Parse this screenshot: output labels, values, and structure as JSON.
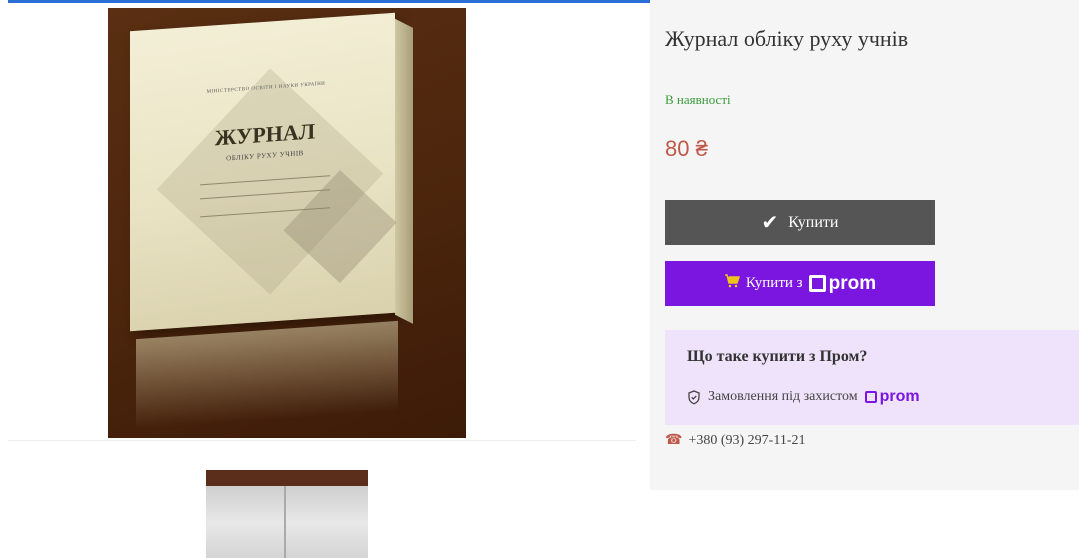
{
  "product": {
    "title": "Журнал обліку руху учнів",
    "availability": "В наявності",
    "price": "80 ₴"
  },
  "book_cover": {
    "ministry": "МІНІСТЕРСТВО ОСВІТИ І НАУКИ УКРАЇНИ",
    "title": "ЖУРНАЛ",
    "subtitle": "ОБЛІКУ РУХУ УЧНІВ"
  },
  "buttons": {
    "buy_label": "Купити",
    "buy_with_prom_label": "Купити з",
    "prom_logo_text": "prom"
  },
  "prom_info": {
    "title": "Що таке купити з Пром?",
    "protection_text": "Замовлення під захистом",
    "prom_logo_text": "prom"
  },
  "contact": {
    "phone": "+380 (93) 297-11-21"
  },
  "icons": {
    "buy": "check-icon",
    "prom_cart": "cart-icon",
    "protection": "shield-icon",
    "phone": "phone-icon"
  },
  "colors": {
    "buy_button": "#555555",
    "prom_button": "#7b16e0",
    "price": "#c0584a",
    "availability": "#3a9a3a",
    "prom_box_bg": "#efe3fb"
  }
}
